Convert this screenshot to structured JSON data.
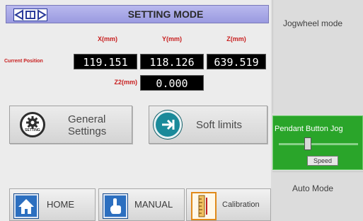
{
  "header": {
    "title": "SETTING MODE"
  },
  "position": {
    "row_label": "Current Position",
    "x": {
      "label": "X(mm)",
      "value": "119.151"
    },
    "y": {
      "label": "Y(mm)",
      "value": "118.126"
    },
    "z": {
      "label": "Z(mm)",
      "value": "639.519"
    },
    "z2": {
      "label": "Z2(mm)",
      "value": "0.000"
    }
  },
  "buttons": {
    "general_settings": {
      "line1": "General",
      "line2": "Settings",
      "icon_text": "SETTING"
    },
    "soft_limits": {
      "label": "Soft limits"
    }
  },
  "nav": {
    "home": "HOME",
    "manual": "MANUAL",
    "calibration": "Calibration"
  },
  "side": {
    "jogwheel": "Jogwheel mode",
    "pendant": "Pendant Button Jog",
    "speed_label": "Speed",
    "speed_level": 0.35,
    "auto": "Auto Mode"
  },
  "colors": {
    "title_bar": "#a6a6e6",
    "axis_label": "#c81e1e",
    "readout_bg": "#000000",
    "pendant_active": "#2aa52a",
    "nav_icon": "#2c6fc0",
    "soft_limits_icon": "#1a8a9a"
  },
  "icons": {
    "logo": "logo-icon",
    "general_settings": "gear-icon",
    "soft_limits": "arrow-right-circle-icon",
    "home": "home-icon",
    "manual": "hand-pointer-icon",
    "calibration": "ruler-icon"
  }
}
